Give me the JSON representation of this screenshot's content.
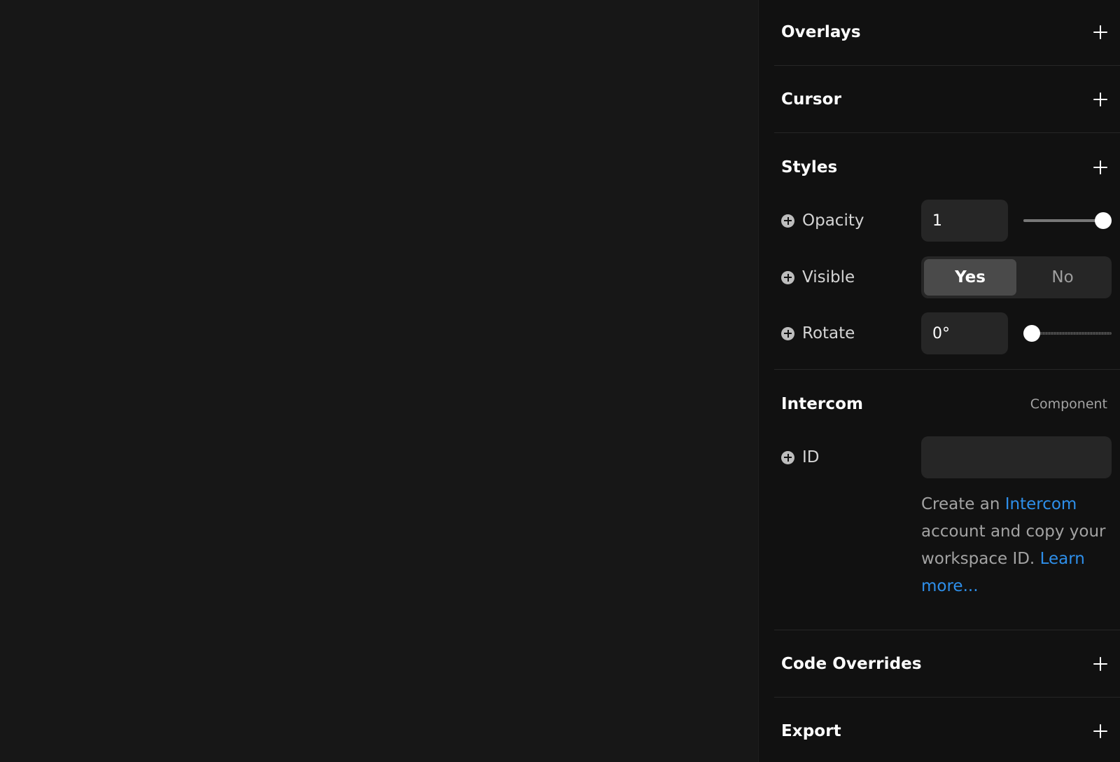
{
  "sections": {
    "overlays": {
      "title": "Overlays"
    },
    "cursor": {
      "title": "Cursor"
    },
    "styles": {
      "title": "Styles",
      "opacity": {
        "label": "Opacity",
        "value": "1",
        "slider_fraction": 1.0
      },
      "visible": {
        "label": "Visible",
        "options": [
          "Yes",
          "No"
        ],
        "selected": "Yes"
      },
      "rotate": {
        "label": "Rotate",
        "value": "0°",
        "slider_fraction": 0.0
      }
    },
    "intercom": {
      "title": "Intercom",
      "badge": "Component",
      "id": {
        "label": "ID",
        "value": ""
      },
      "help": {
        "prefix": "Create an ",
        "link1": "Intercom",
        "middle": " account and copy your workspace ID. ",
        "link2": "Learn more..."
      }
    },
    "code_overrides": {
      "title": "Code Overrides"
    },
    "export": {
      "title": "Export"
    }
  },
  "colors": {
    "canvas_bg": "#171717",
    "panel_bg": "#111111",
    "link": "#2e8fea",
    "input_bg": "#262626"
  },
  "icons": {
    "add_section": "plus-icon",
    "add_property": "plus-circle-icon"
  }
}
